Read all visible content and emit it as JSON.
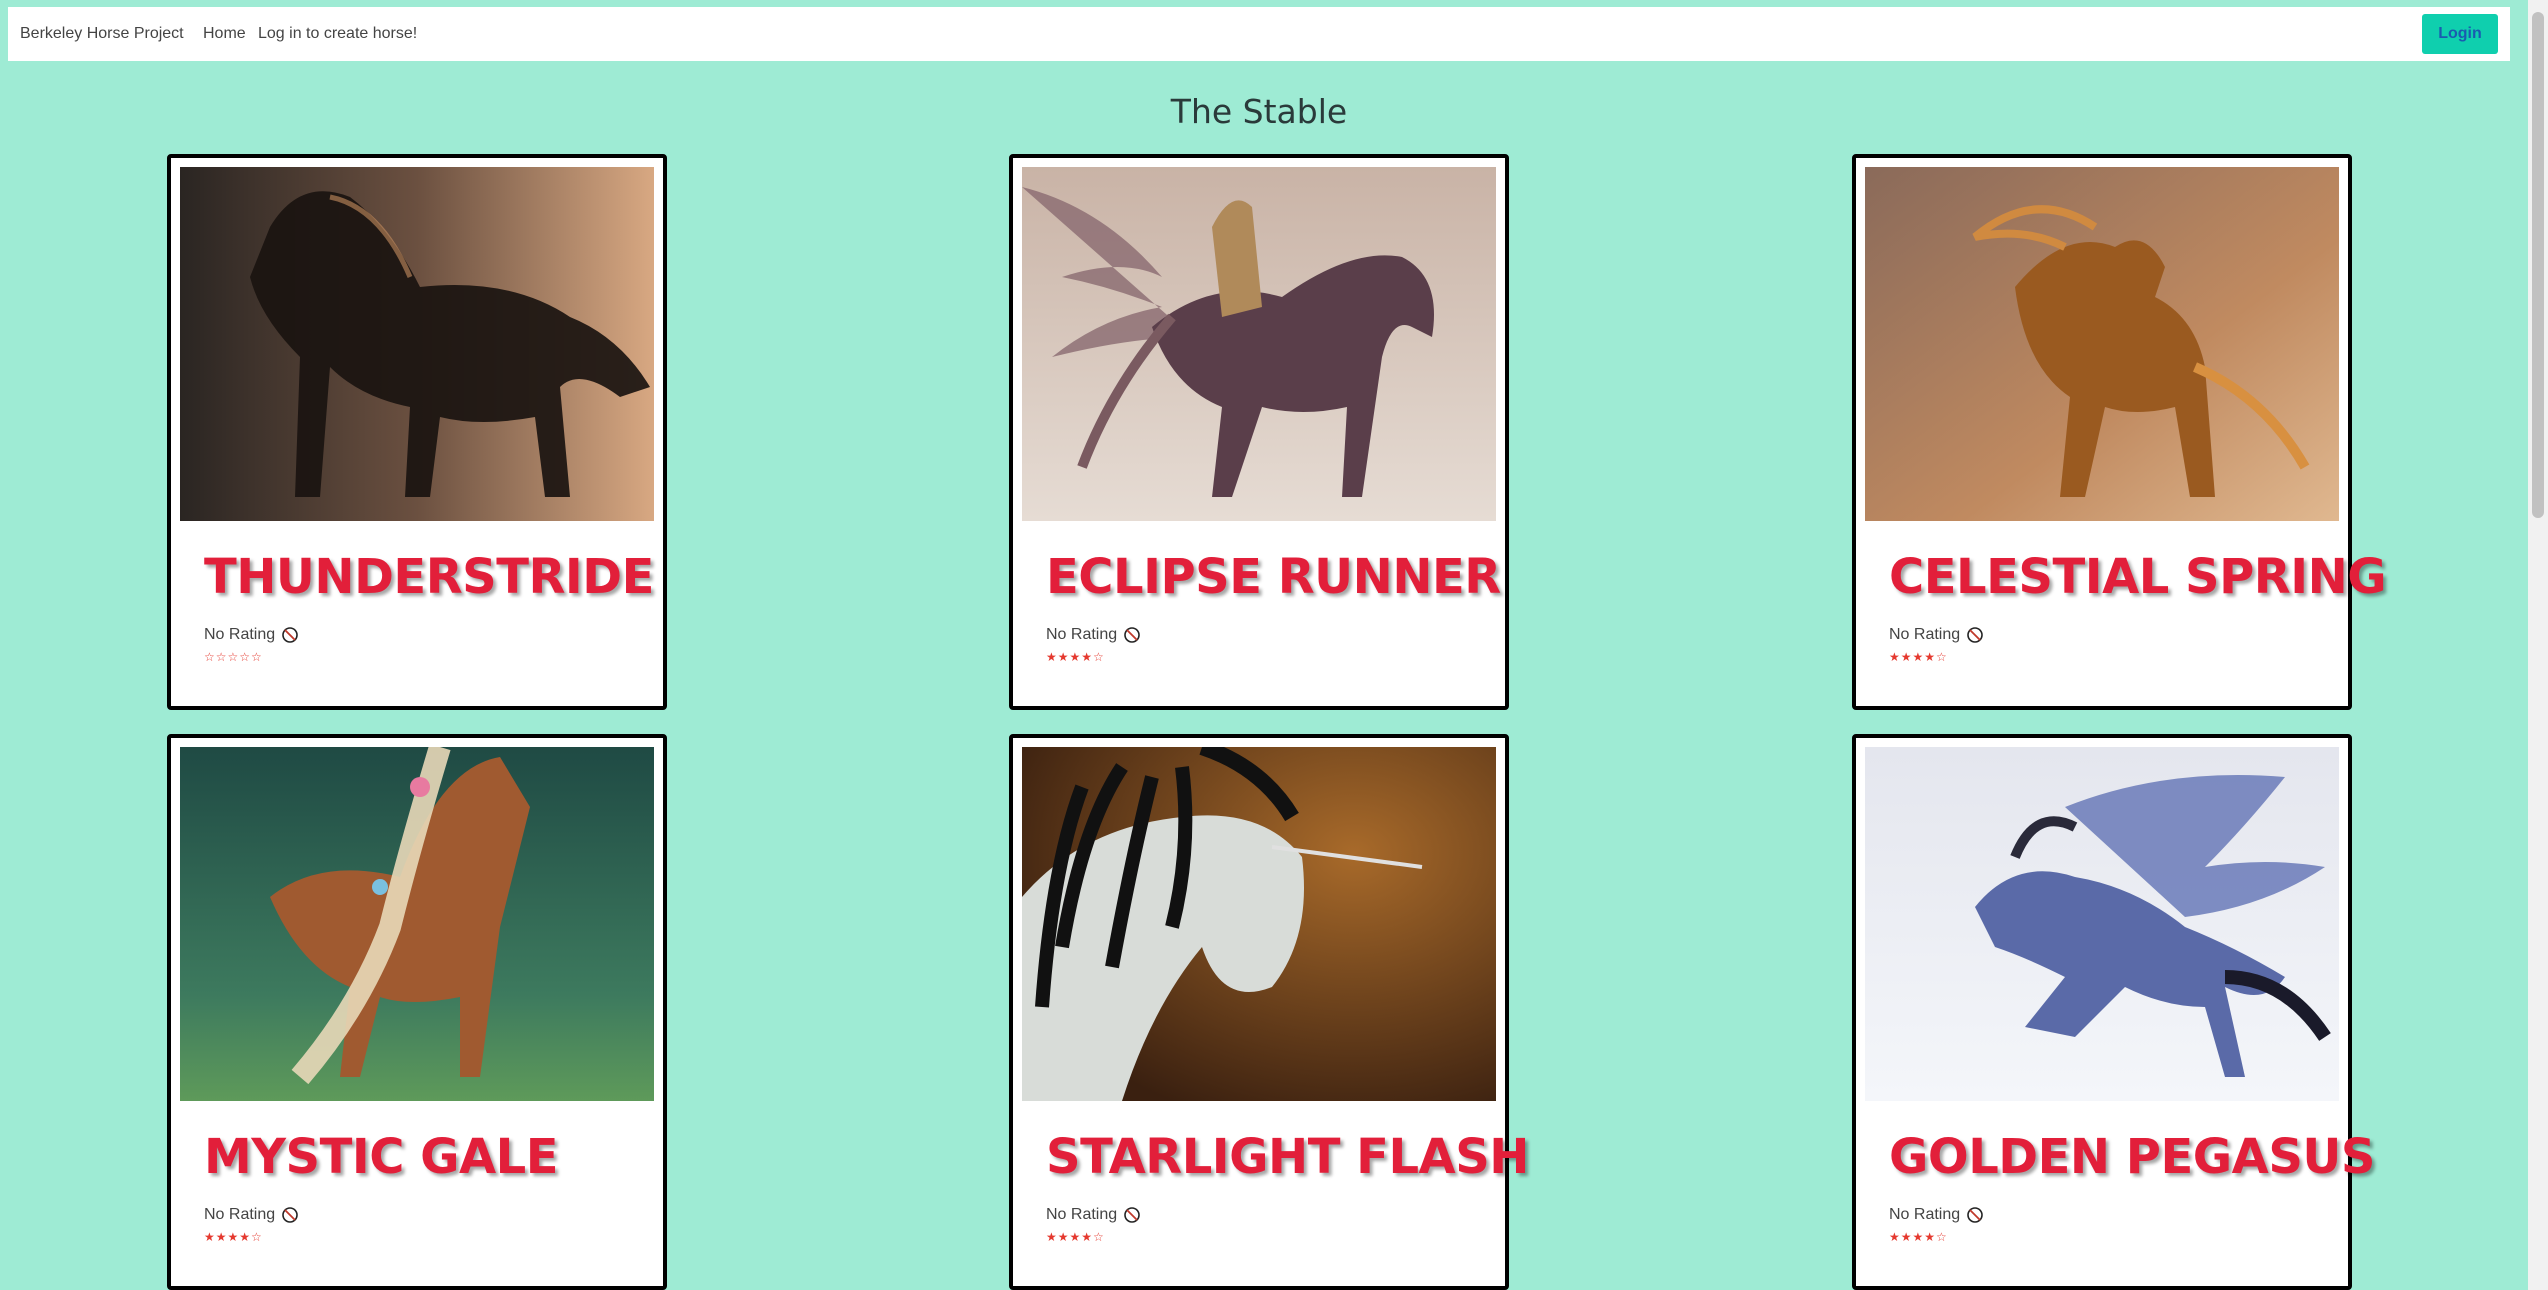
{
  "nav": {
    "brand": "Berkeley Horse Project",
    "home": "Home",
    "create": "Log in to create horse!",
    "login": "Login"
  },
  "page": {
    "title": "The Stable"
  },
  "cards": [
    {
      "name": "THUNDERSTRIDE",
      "rating_text": "No Rating",
      "stars": "☆☆☆☆☆",
      "rating_value": 0,
      "rating_max": 5
    },
    {
      "name": "ECLIPSE RUNNER",
      "rating_text": "No Rating",
      "stars": "★★★★☆",
      "rating_value": 4,
      "rating_max": 5
    },
    {
      "name": "CELESTIAL SPRING",
      "rating_text": "No Rating",
      "stars": "★★★★☆",
      "rating_value": 4,
      "rating_max": 5
    },
    {
      "name": "MYSTIC GALE",
      "rating_text": "No Rating",
      "stars": "★★★★☆",
      "rating_value": 4,
      "rating_max": 5
    },
    {
      "name": "STARLIGHT FLASH",
      "rating_text": "No Rating",
      "stars": "★★★★☆",
      "rating_value": 4,
      "rating_max": 5
    },
    {
      "name": "GOLDEN PEGASUS",
      "rating_text": "No Rating",
      "stars": "★★★★☆",
      "rating_value": 4,
      "rating_max": 5
    }
  ],
  "colors": {
    "background": "#9eebd4",
    "title_red": "#e21f3a",
    "login_bg": "#0fcfae",
    "login_text": "#1a5bb0"
  },
  "icons": {
    "no_rating": "prohibited-icon"
  }
}
